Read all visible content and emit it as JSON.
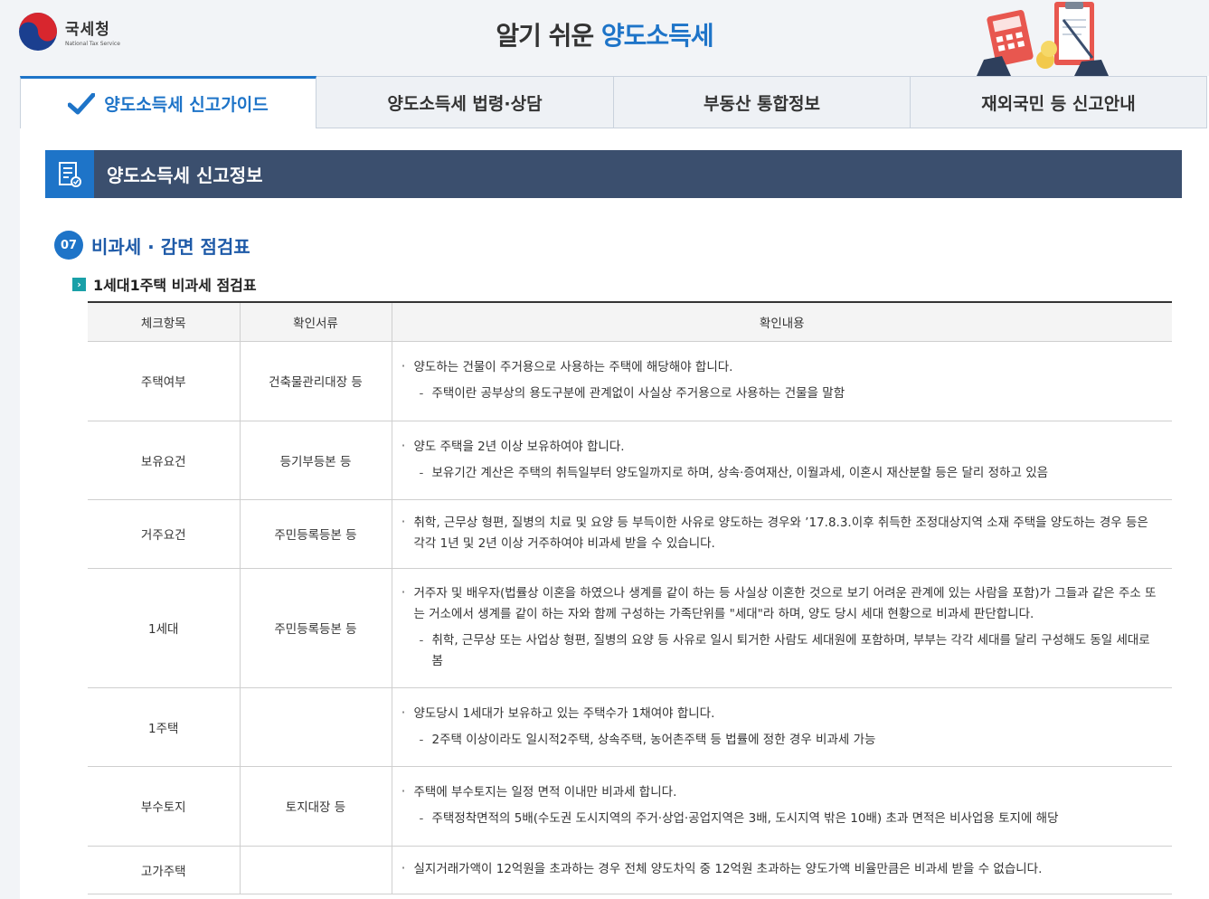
{
  "header": {
    "logo_kr": "국세청",
    "logo_en": "National Tax Service",
    "title_prefix": "알기 쉬운",
    "title_highlight": "양도소득세"
  },
  "tabs": [
    {
      "label": "양도소득세 신고가이드",
      "active": true
    },
    {
      "label": "양도소득세 법령·상담",
      "active": false
    },
    {
      "label": "부동산 통합정보",
      "active": false
    },
    {
      "label": "재외국민 등 신고안내",
      "active": false
    }
  ],
  "banner": {
    "title": "양도소득세 신고정보"
  },
  "section": {
    "number": "07",
    "title": "비과세 · 감면 점검표"
  },
  "subsection": {
    "title": "1세대1주택 비과세 점검표"
  },
  "table": {
    "headers": [
      "체크항목",
      "확인서류",
      "확인내용"
    ],
    "rows": [
      {
        "item": "주택여부",
        "doc": "건축물관리대장 등",
        "bullet": "양도하는 건물이 주거용으로 사용하는 주택에 해당해야 합니다.",
        "dash": "주택이란 공부상의 용도구분에 관계없이 사실상 주거용으로 사용하는 건물을 말함"
      },
      {
        "item": "보유요건",
        "doc": "등기부등본 등",
        "bullet": "양도 주택을 2년 이상 보유하여야 합니다.",
        "dash": "보유기간 계산은 주택의 취득일부터 양도일까지로 하며, 상속·증여재산, 이월과세, 이혼시 재산분할 등은 달리 정하고 있음"
      },
      {
        "item": "거주요건",
        "doc": "주민등록등본 등",
        "bullet": "취학, 근무상 형편, 질병의 치료 및 요양 등 부득이한 사유로 양도하는 경우와 ’17.8.3.이후 취득한 조정대상지역 소재 주택을 양도하는 경우 등은 각각 1년 및 2년 이상 거주하여야 비과세 받을 수 있습니다.",
        "dash": ""
      },
      {
        "item": "1세대",
        "doc": "주민등록등본 등",
        "bullet": "거주자 및 배우자(법률상 이혼을 하였으나 생계를 같이 하는 등 사실상 이혼한 것으로 보기 어려운 관계에 있는 사람을 포함)가 그들과 같은 주소 또는 거소에서 생계를 같이 하는 자와 함께 구성하는 가족단위를 \"세대\"라 하며, 양도 당시 세대 현황으로 비과세 판단합니다.",
        "dash": "취학, 근무상 또는 사업상 형편, 질병의 요양 등 사유로 일시 퇴거한 사람도 세대원에 포함하며, 부부는 각각 세대를 달리 구성해도 동일 세대로 봄"
      },
      {
        "item": "1주택",
        "doc": "",
        "bullet": "양도당시 1세대가 보유하고 있는 주택수가 1채여야 합니다.",
        "dash": "2주택 이상이라도 일시적2주택, 상속주택, 농어촌주택 등 법률에 정한 경우 비과세 가능"
      },
      {
        "item": "부수토지",
        "doc": "토지대장 등",
        "bullet": "주택에 부수토지는 일정 면적 이내만 비과세 합니다.",
        "dash": "주택정착면적의 5배(수도권 도시지역의 주거·상업·공업지역은 3배, 도시지역 밖은 10배) 초과 면적은 비사업용 토지에 해당"
      },
      {
        "item": "고가주택",
        "doc": "",
        "bullet": "실지거래가액이 12억원을 초과하는 경우 전체 양도차익 중 12억원 초과하는 양도가액 비율만큼은 비과세 받을 수 없습니다.",
        "dash": ""
      }
    ]
  },
  "colors": {
    "accent": "#1e74c8",
    "banner": "#3b4f6e",
    "sub_icon": "#1aa0a8"
  }
}
